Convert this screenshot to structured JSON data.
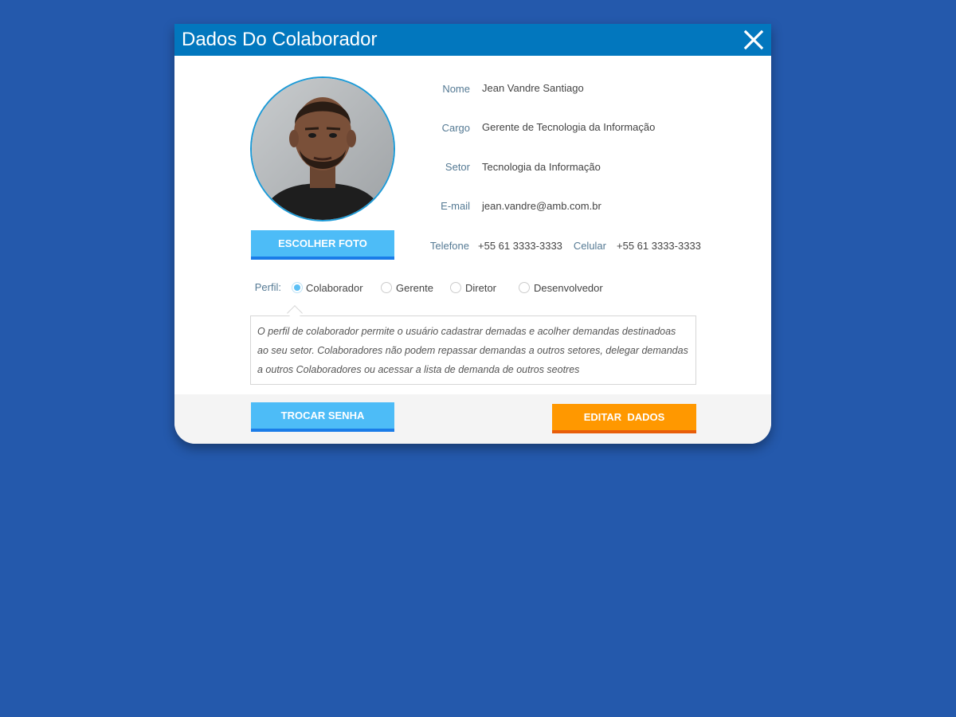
{
  "modal": {
    "title": "Dados Do Colaborador",
    "close_icon": "close-icon"
  },
  "profile": {
    "photo_icon": "user-photo",
    "choose_photo_label": "ESCOLHER FOTO"
  },
  "fields": {
    "name_label": "Nome",
    "name_value": "Jean Vandre Santiago",
    "role_label": "Cargo",
    "role_value": "Gerente de Tecnologia da Informação",
    "sector_label": "Setor",
    "sector_value": "Tecnologia da Informação",
    "email_label": "E-mail",
    "email_value": "jean.vandre@amb.com.br",
    "phone_label": "Telefone",
    "phone_value": "+55 61 3333-3333",
    "mobile_label": "Celular",
    "mobile_value": "+55 61 3333-3333"
  },
  "perfil": {
    "label": "Perfil:",
    "options": [
      "Colaborador",
      "Gerente",
      "Diretor",
      "Desenvolvedor"
    ],
    "selected": "Colaborador",
    "description": "O perfil de colaborador permite o usuário cadastrar demadas e acolher demandas destinadoas ao seu setor. Colaboradores não podem repassar demandas a outros setores, delegar demandas a outros Colaboradores ou acessar a lista de demanda de outros seotres"
  },
  "footer": {
    "change_password_label": "TROCAR SENHA",
    "edit_data_label": "EDITAR  DADOS"
  },
  "colors": {
    "background": "#2459ac",
    "titlebar": "#0277be",
    "button_blue": "#4dbcf7",
    "button_orange": "#ff9800"
  }
}
